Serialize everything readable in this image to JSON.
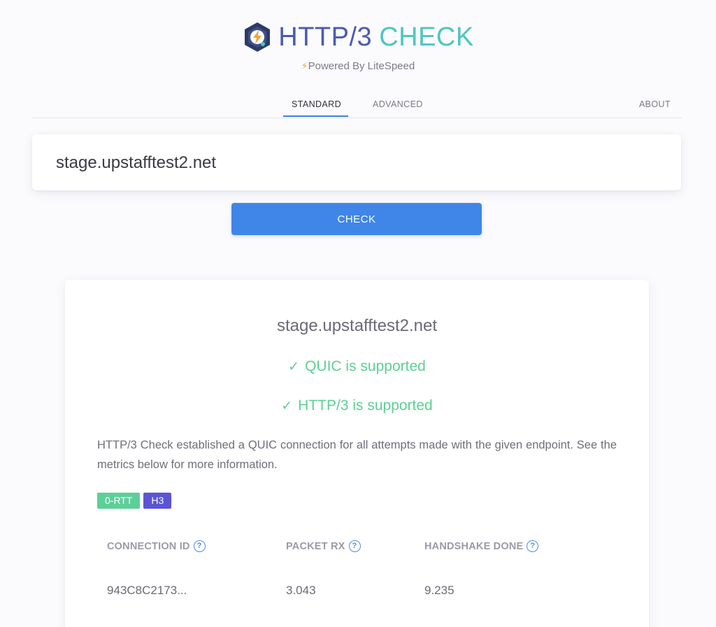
{
  "brand": {
    "title_part1": "HTTP/3",
    "title_part2": "CHECK",
    "powered_by": "Powered By LiteSpeed",
    "logo_icon": "litespeed-hexagon-icon",
    "powered_icon": "lightning-bolt-icon"
  },
  "tabs": {
    "standard": "STANDARD",
    "advanced": "ADVANCED",
    "about": "ABOUT",
    "active": "STANDARD"
  },
  "input": {
    "value": "stage.upstafftest2.net"
  },
  "check_button": {
    "label": "CHECK"
  },
  "result": {
    "host": "stage.upstafftest2.net",
    "quic_status": "QUIC is supported",
    "http3_status": "HTTP/3 is supported",
    "check_glyph": "✓",
    "description": "HTTP/3 Check established a QUIC connection for all attempts made with the given endpoint. See the metrics below for more information.",
    "badges": [
      "0-RTT",
      "H3"
    ],
    "metrics": {
      "headers": [
        "CONNECTION ID",
        "PACKET RX",
        "HANDSHAKE DONE"
      ],
      "values": [
        "943C8C2173...",
        "3.043",
        "9.235"
      ],
      "help_glyph": "?"
    }
  },
  "colors": {
    "accent_blue": "#3f86e8",
    "success_green": "#5ccf95",
    "badge_0rtt": "#5dcf98",
    "badge_h3": "#5b55d6",
    "brand_blue": "#4a5ab4",
    "brand_teal": "#4dc6c3"
  }
}
